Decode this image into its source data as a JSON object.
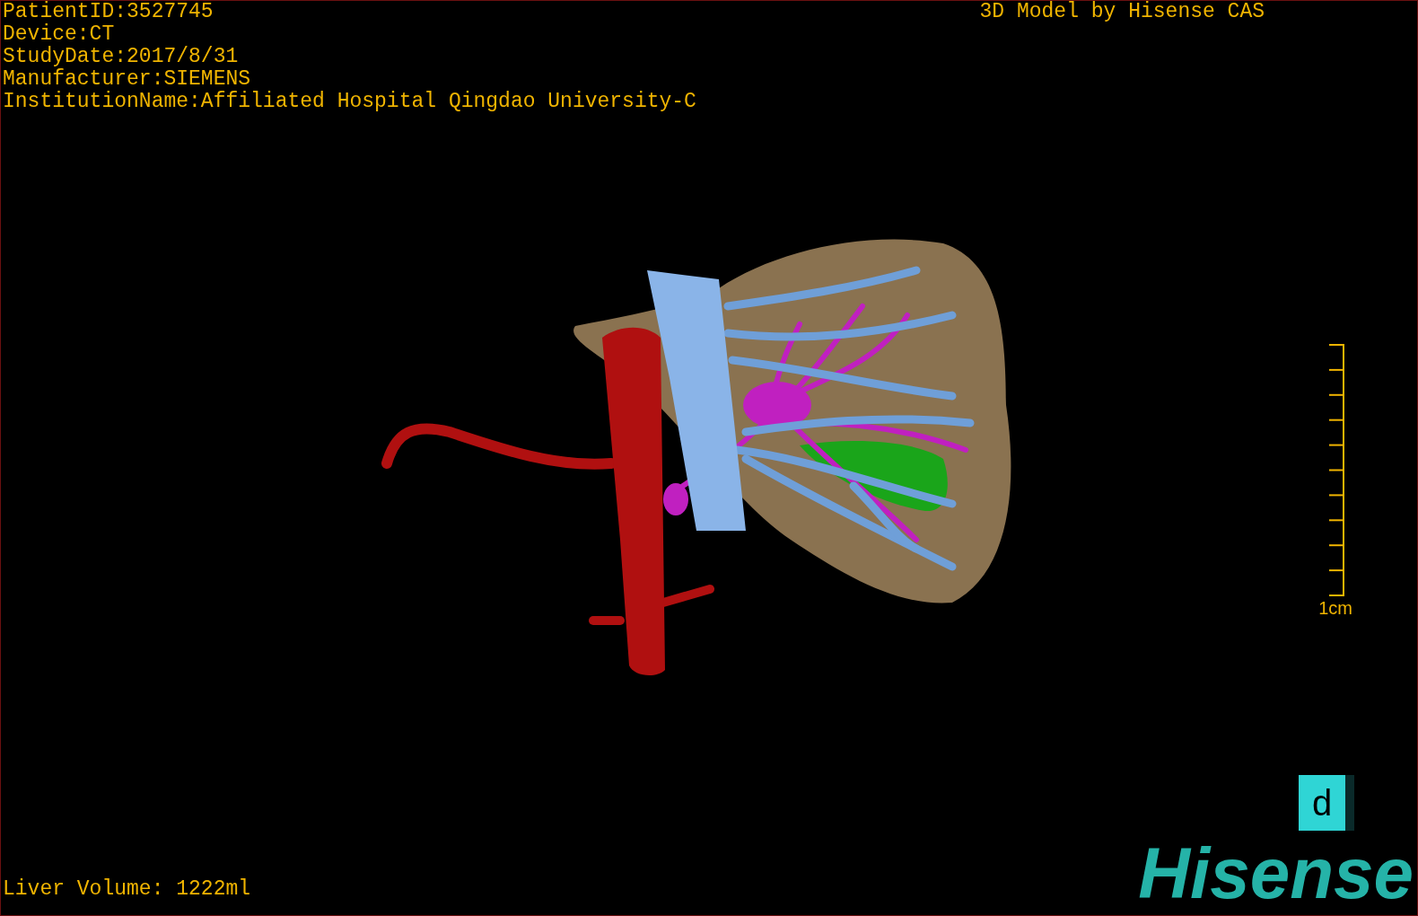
{
  "info_lines": [
    "PatientID:3527745",
    "Device:CT",
    "StudyDate:2017/8/31",
    "Manufacturer:SIEMENS",
    "InstitutionName:Affiliated Hospital Qingdao University-C"
  ],
  "title": "3D Model by Hisense CAS",
  "scale_bar": {
    "label": "1cm"
  },
  "liver_volume": "Liver Volume: 1222ml",
  "view_button": {
    "label": "d"
  },
  "logo": "Hisense"
}
